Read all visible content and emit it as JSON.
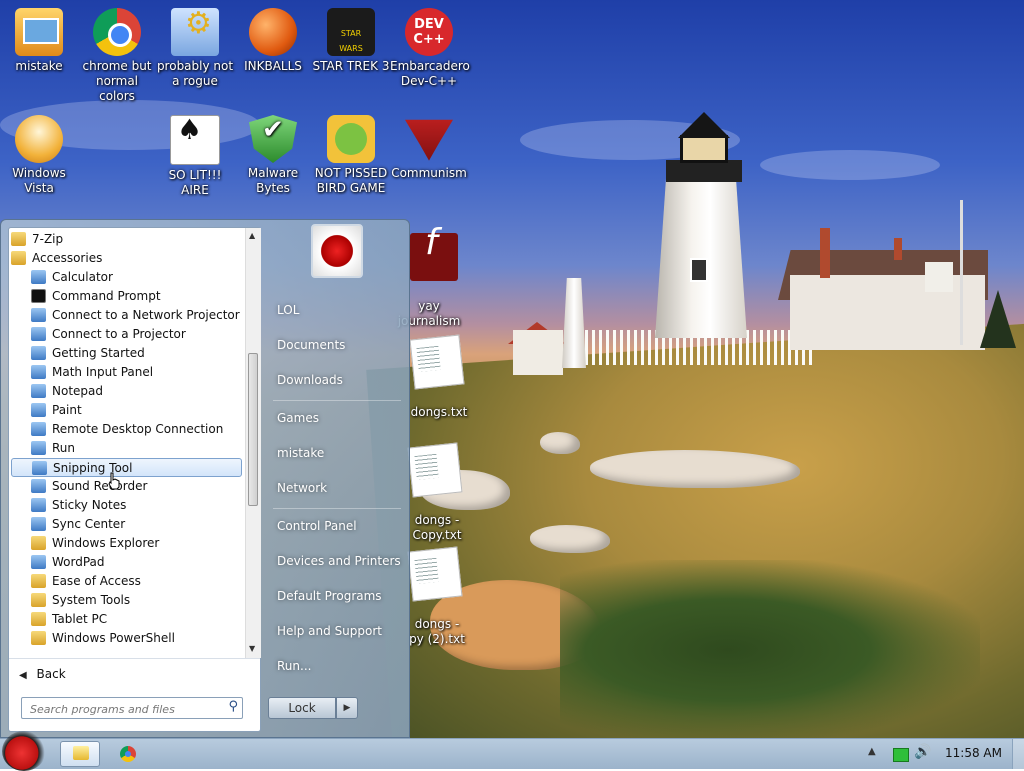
{
  "desktop_icons": [
    {
      "label": "mistake",
      "icon": "mistake-app-icon"
    },
    {
      "label": "chrome but normal colors",
      "icon": "chrome-icon"
    },
    {
      "label": "probably not a rogue",
      "icon": "gear-shortcut-icon"
    },
    {
      "label": "INKBALLS",
      "icon": "inkballs-icon"
    },
    {
      "label": "STAR TREK 3",
      "icon": "star-wars-icon"
    },
    {
      "label": "Embarcadero Dev-C++",
      "icon": "devcpp-icon"
    },
    {
      "label": "Windows Vista",
      "icon": "egg-icon"
    },
    {
      "label": "SO LIT!!! AIRE",
      "icon": "solitaire-card-icon"
    },
    {
      "label": "Malware Bytes",
      "icon": "shield-check-icon"
    },
    {
      "label": "NOT PISSED BIRD GAME",
      "icon": "green-pig-icon"
    },
    {
      "label": "Communism",
      "icon": "red-emblem-icon"
    },
    {
      "label": "yay\njournalism",
      "icon": "flash-icon"
    },
    {
      "label": "dongs.txt",
      "icon": "text-file-icon"
    },
    {
      "label": "dongs -\nCopy.txt",
      "icon": "text-file-icon"
    },
    {
      "label": "dongs -\npy (2).txt",
      "icon": "text-file-icon"
    }
  ],
  "devcpp_badge": "DEV\nC++",
  "start_menu": {
    "programs": [
      {
        "label": "7-Zip",
        "type": "folder"
      },
      {
        "label": "Accessories",
        "type": "folder"
      },
      {
        "label": "Calculator",
        "type": "app"
      },
      {
        "label": "Command Prompt",
        "type": "cmd"
      },
      {
        "label": "Connect to a Network Projector",
        "type": "app"
      },
      {
        "label": "Connect to a Projector",
        "type": "app"
      },
      {
        "label": "Getting Started",
        "type": "app"
      },
      {
        "label": "Math Input Panel",
        "type": "app"
      },
      {
        "label": "Notepad",
        "type": "app"
      },
      {
        "label": "Paint",
        "type": "app"
      },
      {
        "label": "Remote Desktop Connection",
        "type": "app"
      },
      {
        "label": "Run",
        "type": "app"
      },
      {
        "label": "Snipping Tool",
        "type": "app",
        "selected": true
      },
      {
        "label": "Sound Recorder",
        "type": "app"
      },
      {
        "label": "Sticky Notes",
        "type": "app"
      },
      {
        "label": "Sync Center",
        "type": "app"
      },
      {
        "label": "Windows Explorer",
        "type": "folder"
      },
      {
        "label": "WordPad",
        "type": "app"
      },
      {
        "label": "Ease of Access",
        "type": "folder"
      },
      {
        "label": "System Tools",
        "type": "folder"
      },
      {
        "label": "Tablet PC",
        "type": "folder"
      },
      {
        "label": "Windows PowerShell",
        "type": "folder"
      }
    ],
    "back_label": "Back",
    "search_placeholder": "Search programs and files",
    "right_links": [
      "LOL",
      "Documents",
      "Downloads",
      "Games",
      "mistake",
      "Network",
      "Control Panel",
      "Devices and Printers",
      "Default Programs",
      "Help and Support",
      "Run..."
    ],
    "lock_label": "Lock"
  },
  "taskbar": {
    "clock": "11:58 AM"
  },
  "colors": {
    "selection_border": "#7da2ce",
    "sky": "#3d63c6"
  }
}
